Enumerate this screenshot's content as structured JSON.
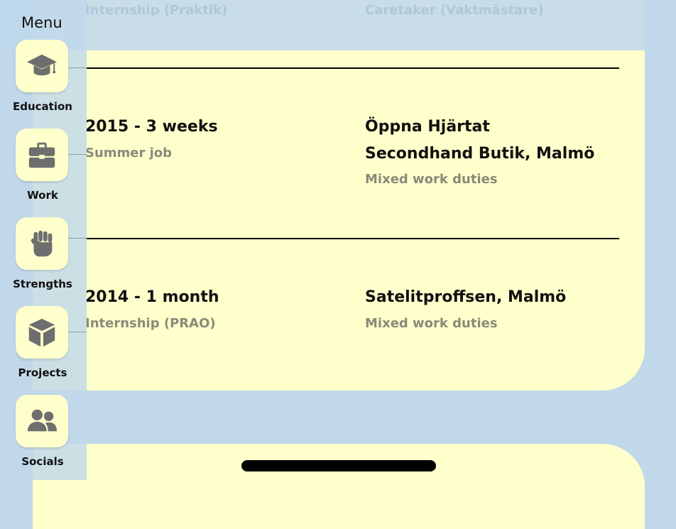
{
  "top_faded": {
    "left": "Internship (Praktik)",
    "right": "Caretaker (Vaktmästare)"
  },
  "entries": [
    {
      "period": "2015 - 3 weeks",
      "role": "Summer job",
      "place": "Öppna Hjärtat Secondhand Butik, Malmö",
      "duty": "Mixed work duties"
    },
    {
      "period": "2014 - 1 month",
      "role": "Internship (PRAO)",
      "place": "Satelitproffsen, Malmö",
      "duty": "Mixed work duties"
    }
  ],
  "menu": {
    "title": "Menu",
    "items": [
      {
        "label": "Education",
        "icon": "graduation-cap-icon"
      },
      {
        "label": "Work",
        "icon": "briefcase-icon"
      },
      {
        "label": "Strengths",
        "icon": "fist-icon"
      },
      {
        "label": "Projects",
        "icon": "cube-icon"
      },
      {
        "label": "Socials",
        "icon": "users-icon"
      }
    ]
  },
  "colors": {
    "card": "#ffffcc",
    "background": "#c0d8ea",
    "icon": "#6e6e6e",
    "muted_text": "#8a8a7a"
  }
}
